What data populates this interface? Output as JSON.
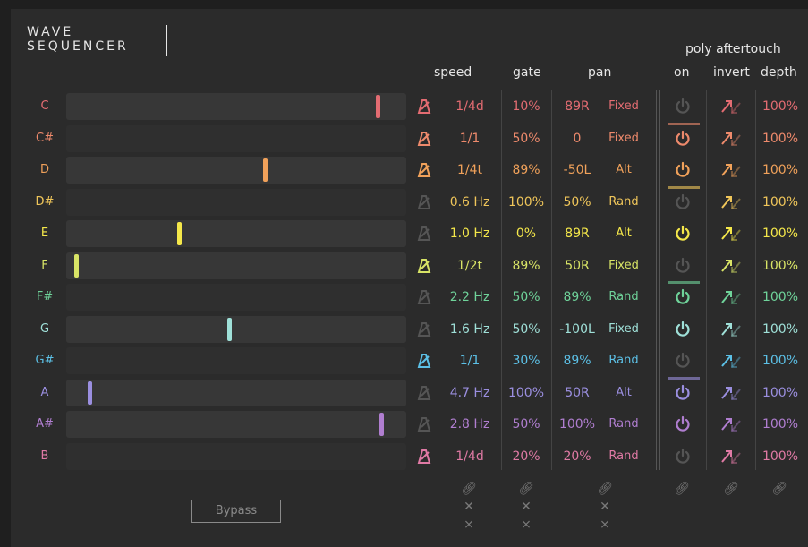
{
  "title": [
    "WAVE",
    "SEQUENCER"
  ],
  "headers": {
    "speed": "speed",
    "gate": "gate",
    "pan": "pan",
    "poly_group": "poly aftertouch",
    "on": "on",
    "invert": "invert",
    "depth": "depth"
  },
  "bypass_label": "Bypass",
  "colors": {
    "panel": "#2b2b2b",
    "track": "#373737",
    "dim_icon": "#555555"
  },
  "rows": [
    {
      "note": "C",
      "color": "#e36c72",
      "has_track": true,
      "marker": 0.93,
      "sync": true,
      "speed": "1/4d",
      "gate": "10%",
      "pan": "89R",
      "mode": "Fixed",
      "on": false,
      "on_bar": false,
      "depth": "100%"
    },
    {
      "note": "C#",
      "color": "#ee8a6c",
      "has_track": false,
      "marker": null,
      "sync": true,
      "speed": "1/1",
      "gate": "50%",
      "pan": "0",
      "mode": "Fixed",
      "on": true,
      "on_bar": true,
      "depth": "100%"
    },
    {
      "note": "D",
      "color": "#f0a15a",
      "has_track": true,
      "marker": 0.59,
      "sync": true,
      "speed": "1/4t",
      "gate": "89%",
      "pan": "-50L",
      "mode": "Alt",
      "on": true,
      "on_bar": false,
      "depth": "100%"
    },
    {
      "note": "D#",
      "color": "#f0c65a",
      "has_track": false,
      "marker": null,
      "sync": false,
      "speed": "0.6 Hz",
      "gate": "100%",
      "pan": "50%",
      "mode": "Rand",
      "on": false,
      "on_bar": true,
      "depth": "100%"
    },
    {
      "note": "E",
      "color": "#f5e84a",
      "has_track": true,
      "marker": 0.33,
      "sync": false,
      "speed": "1.0 Hz",
      "gate": "0%",
      "pan": "89R",
      "mode": "Alt",
      "on": true,
      "on_bar": false,
      "depth": "100%"
    },
    {
      "note": "F",
      "color": "#d8e466",
      "has_track": true,
      "marker": 0.02,
      "sync": true,
      "speed": "1/2t",
      "gate": "89%",
      "pan": "50R",
      "mode": "Fixed",
      "on": false,
      "on_bar": false,
      "depth": "100%"
    },
    {
      "note": "F#",
      "color": "#6fd39a",
      "has_track": false,
      "marker": null,
      "sync": false,
      "speed": "2.2 Hz",
      "gate": "50%",
      "pan": "89%",
      "mode": "Rand",
      "on": true,
      "on_bar": true,
      "depth": "100%"
    },
    {
      "note": "G",
      "color": "#9fe0d8",
      "has_track": true,
      "marker": 0.48,
      "sync": false,
      "speed": "1.6 Hz",
      "gate": "50%",
      "pan": "-100L",
      "mode": "Fixed",
      "on": true,
      "on_bar": false,
      "depth": "100%"
    },
    {
      "note": "G#",
      "color": "#5cc0e6",
      "has_track": false,
      "marker": null,
      "sync": true,
      "speed": "1/1",
      "gate": "30%",
      "pan": "89%",
      "mode": "Rand",
      "on": false,
      "on_bar": false,
      "depth": "100%"
    },
    {
      "note": "A",
      "color": "#9b8fe0",
      "has_track": true,
      "marker": 0.06,
      "sync": false,
      "speed": "4.7 Hz",
      "gate": "100%",
      "pan": "50R",
      "mode": "Alt",
      "on": true,
      "on_bar": true,
      "depth": "100%"
    },
    {
      "note": "A#",
      "color": "#b07ed0",
      "has_track": true,
      "marker": 0.94,
      "sync": false,
      "speed": "2.8 Hz",
      "gate": "50%",
      "pan": "100%",
      "mode": "Rand",
      "on": true,
      "on_bar": false,
      "depth": "100%"
    },
    {
      "note": "B",
      "color": "#e07aa5",
      "has_track": false,
      "marker": null,
      "sync": true,
      "speed": "1/4d",
      "gate": "20%",
      "pan": "20%",
      "mode": "Rand",
      "on": false,
      "on_bar": false,
      "depth": "100%"
    }
  ],
  "footer": {
    "link_icon": "link-icon",
    "reset_icon": "close-x-icon",
    "random_icon": "shuffle-icon"
  }
}
